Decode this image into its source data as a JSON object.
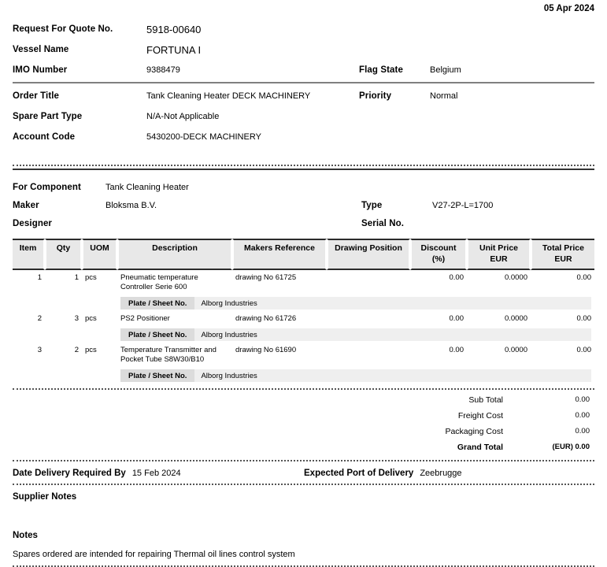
{
  "document": {
    "date": "05 Apr 2024"
  },
  "header": {
    "fields": [
      {
        "label": "Request For Quote No.",
        "value": "5918-00640",
        "size": "lg"
      },
      {
        "label": "Vessel Name",
        "value": "FORTUNA I",
        "size": "lg"
      },
      {
        "label": "IMO Number",
        "value": "9388479",
        "size": "sm",
        "label2": "Flag State",
        "value2": "Belgium"
      },
      {
        "label": "Order Title",
        "value": "Tank Cleaning Heater DECK MACHINERY",
        "size": "sm",
        "label2": "Priority",
        "value2": "Normal"
      },
      {
        "label": "Spare Part Type",
        "value": "N/A-Not Applicable",
        "size": "sm"
      },
      {
        "label": "Account Code",
        "value": "5430200-DECK MACHINERY",
        "size": "sm"
      }
    ]
  },
  "component": {
    "rows": [
      {
        "label": "For Component",
        "value": "Tank Cleaning Heater"
      },
      {
        "label": "Maker",
        "value": "Bloksma B.V.",
        "label2": "Type",
        "value2": "V27-2P-L=1700"
      },
      {
        "label": "Designer",
        "value": "",
        "label2": "Serial No.",
        "value2": ""
      }
    ]
  },
  "items_table": {
    "columns": [
      {
        "line1": "Item",
        "line2": ""
      },
      {
        "line1": "Qty",
        "line2": ""
      },
      {
        "line1": "UOM",
        "line2": ""
      },
      {
        "line1": "Description",
        "line2": ""
      },
      {
        "line1": "Makers Reference",
        "line2": ""
      },
      {
        "line1": "Drawing Position",
        "line2": ""
      },
      {
        "line1": "Discount",
        "line2": "(%)"
      },
      {
        "line1": "Unit Price",
        "line2": "EUR"
      },
      {
        "line1": "Total Price",
        "line2": "EUR"
      }
    ],
    "plate_label": "Plate / Sheet No.",
    "rows": [
      {
        "item": "1",
        "qty": "1",
        "uom": "pcs",
        "description": "Pneumatic temperature Controller Serie 600",
        "makers_reference": "drawing No 61725",
        "drawing_position": "",
        "discount": "0.00",
        "unit_price": "0.0000",
        "total_price": "0.00",
        "plate_value": "Alborg Industries"
      },
      {
        "item": "2",
        "qty": "3",
        "uom": "pcs",
        "description": "PS2 Positioner",
        "makers_reference": "drawing No 61726",
        "drawing_position": "",
        "discount": "0.00",
        "unit_price": "0.0000",
        "total_price": "0.00",
        "plate_value": "Alborg Industries"
      },
      {
        "item": "3",
        "qty": "2",
        "uom": "pcs",
        "description": "Temperature Transmitter and Pocket Tube S8W30/B10",
        "makers_reference": "drawing No 61690",
        "drawing_position": "",
        "discount": "0.00",
        "unit_price": "0.0000",
        "total_price": "0.00",
        "plate_value": "Alborg Industries"
      }
    ]
  },
  "totals": {
    "sub_total_label": "Sub Total",
    "sub_total_value": "0.00",
    "freight_label": "Freight Cost",
    "freight_value": "0.00",
    "packaging_label": "Packaging Cost",
    "packaging_value": "0.00",
    "grand_total_label": "Grand Total",
    "grand_total_value": "(EUR) 0.00"
  },
  "delivery": {
    "date_label": "Date Delivery Required By",
    "date_value": "15 Feb 2024",
    "port_label": "Expected Port of Delivery",
    "port_value": "Zeebrugge"
  },
  "supplier_notes": {
    "heading": "Supplier Notes",
    "body": ""
  },
  "notes": {
    "heading": "Notes",
    "body": "Spares ordered are intended for repairing Thermal oil lines  control system"
  }
}
